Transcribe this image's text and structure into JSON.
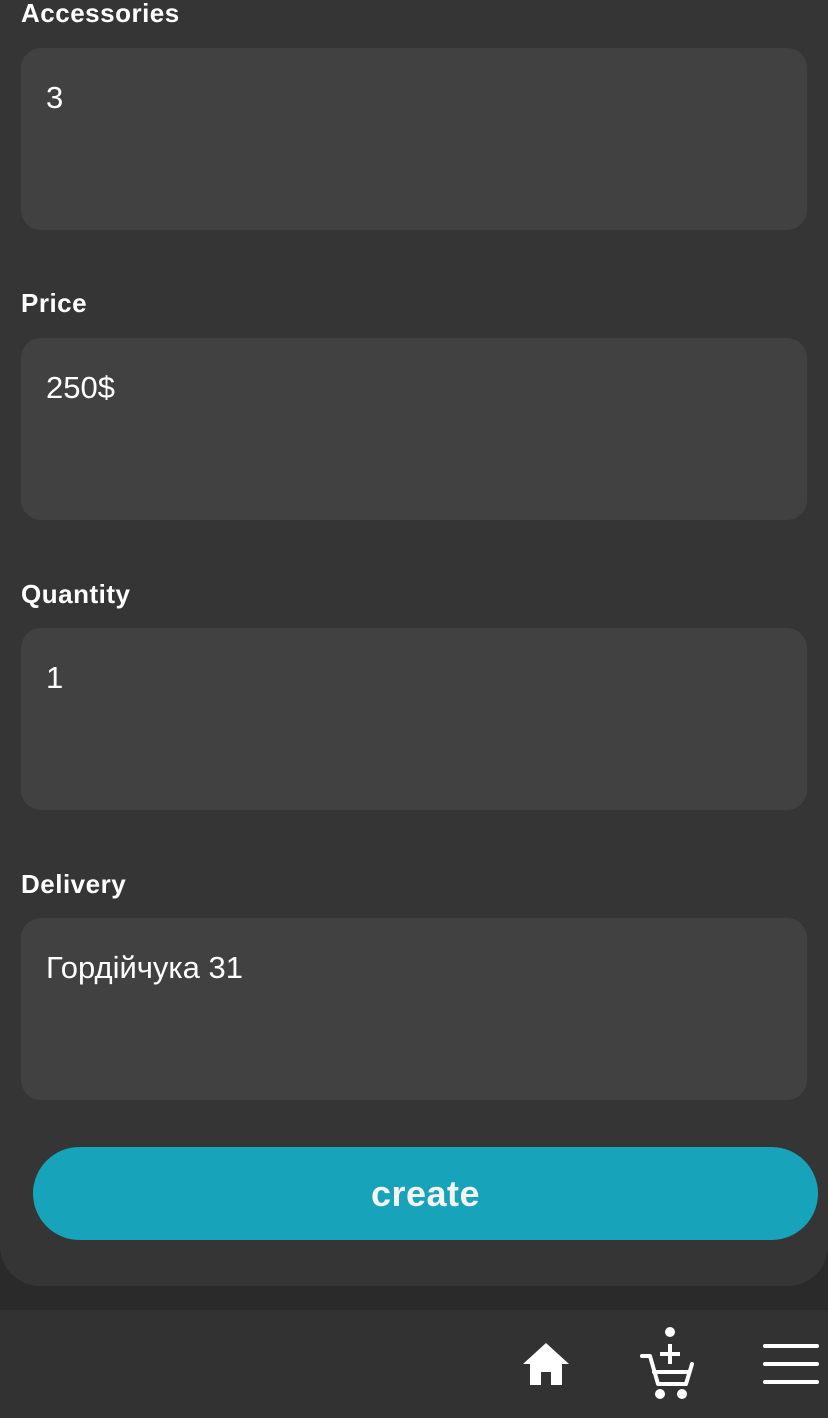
{
  "form": {
    "fields": [
      {
        "label": "Accessories",
        "value": "3"
      },
      {
        "label": "Price",
        "value": "250$"
      },
      {
        "label": "Quantity",
        "value": "1"
      },
      {
        "label": "Delivery",
        "value": "Гордійчука 31"
      }
    ],
    "submit_label": "create"
  },
  "bottom_nav": {
    "items": [
      {
        "icon": "home-icon"
      },
      {
        "icon": "add-to-cart-icon"
      },
      {
        "icon": "menu-icon"
      }
    ]
  },
  "colors": {
    "accent": "#17a3b9",
    "card_background": "#353535",
    "input_background": "#414141",
    "nav_background": "#323232",
    "text": "#ffffff"
  }
}
